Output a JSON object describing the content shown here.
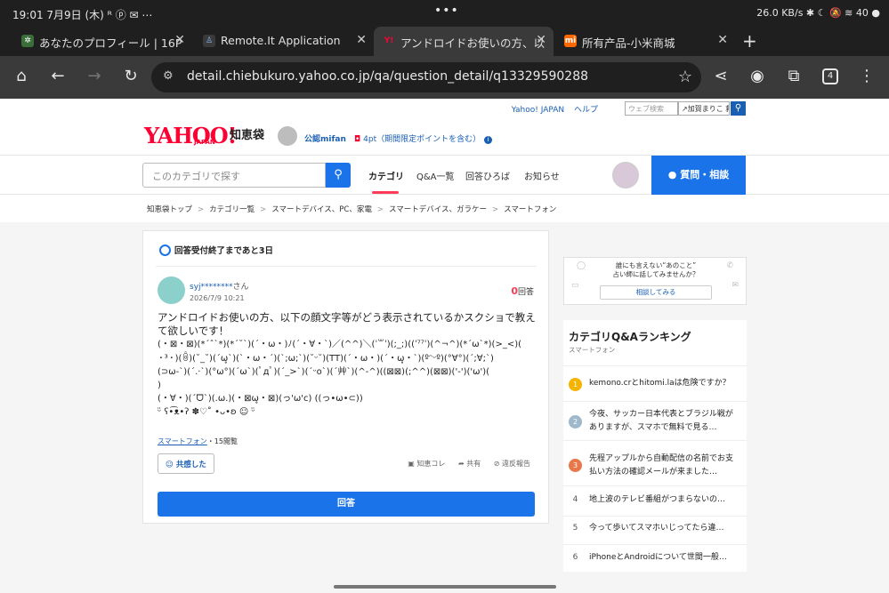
{
  "status_bar": {
    "time_date": "19:01  7月9日 (木)  ᴿ ⓟ ✉ ⋯",
    "center_dots": "•••",
    "right": "26.0 KB/s ✱ ☾ 🔕 ≋ 40 ●"
  },
  "tabs": [
    {
      "favicon": "✲",
      "favicon_color": "#3a6f3a",
      "label": "あなたのプロフィール | 16P",
      "close": "✕"
    },
    {
      "favicon": "♙",
      "favicon_color": "#3a3a3a",
      "label": "Remote.It Application",
      "close": "✕"
    },
    {
      "favicon": "Y!",
      "favicon_color": "#3a3a3a",
      "label": "アンドロイドお使いの方、以",
      "close": "✕"
    },
    {
      "favicon": "mi",
      "favicon_color": "#ff6700",
      "label": "所有产品-小米商城",
      "close": "✕"
    }
  ],
  "new_tab": "+",
  "toolbar": {
    "home": "⌂",
    "back": "←",
    "forward": "→",
    "reload": "↻",
    "url": "detail.chiebukuro.yahoo.co.jp/qa/question_detail/q13329590288",
    "tune": "⚙",
    "star": "☆",
    "share": "⋖",
    "account": "◉",
    "extensions": "⧉",
    "tab_count": "4",
    "menu": "⋮"
  },
  "yahoo_top": {
    "links": [
      "Yahoo! JAPAN",
      "ヘルプ"
    ],
    "web_search_placeholder": "ウェブ検索",
    "area": "↗加賀まりこ 救…",
    "search_btn": "🔍"
  },
  "header": {
    "logo": "YAHOO!",
    "logo_sub": "JAPAN",
    "logo_jp": "知恵袋",
    "user": "公認mifan",
    "points": "4pt（期間限定ポイントを含む）",
    "points_icon": "◘",
    "info_icon": "i"
  },
  "nav": {
    "search_placeholder": "このカテゴリで探す",
    "search_icon": "⚲",
    "items": [
      "カテゴリ",
      "Q&A一覧",
      "回答ひろば",
      "お知らせ"
    ],
    "ask_button": "● 質問・相談"
  },
  "breadcrumb": [
    "知恵袋トップ",
    "カテゴリ一覧",
    "スマートデバイス、PC、家電",
    "スマートデバイス、ガラケー",
    "スマートフォン"
  ],
  "question": {
    "deadline": "回答受付終了まであと3日",
    "user": "syj********",
    "honorific": "さん",
    "date": "2026/7/9 10:21",
    "answer_count": "0",
    "answer_label": "回答",
    "text": "アンドロイドお使いの方、以下の顔文字等がどう表示されているかスクショで教えて欲しいです！",
    "kaomoji": [
      "(・⊠・⊠)(*´ˆ`*)(*´˘`)(´・ω・)ﾉ(´・∀・`)／(^^)＼(ˈ꒳ˈ)(;_;)((ˈ⁷⁷ˈ)(^¬^)(*´ω`*)(>_<)(",
      "・³・)(ꉺ)(˘_˘)(´ω̥`)(`・ω・´)(`;ω;`)(˘ᵕ˘)(TT)(´・ω・)(´・ω̥・`)(ºᵔᵕº)(°∀°)(´;∀;`)",
      "(⊃ω-`)(´.·`)(°ω°)(´ω`)(ﾟдﾟ)(´_>`)(´ᵕo`)(´艸`)(^-^)((⊠⊠)(;^^)(⊠⊠)('-')('ω')(",
      ")",
      "(・∀・)(ˊᗜˋ)(.ω.)(・⊠ω̥・⊠)(っ'ω'c) ((っ•ω•⊂))",
      "ᵕ̈ ʕ•͡ᴥ•ʔ ✽♡˚ •ᴗ•ʚ ☺ ᵕ̈"
    ],
    "category": "スマートフォン",
    "views": "・15閲覧",
    "kyokan": "共感した",
    "actions": [
      "▣ 知恵コレ",
      "➦ 共有",
      "⊘ 違反報告"
    ],
    "answer_button": "回答"
  },
  "ad": {
    "line1": "誰にも言えない“あのこと”",
    "line2": "占い師に話してみませんか？",
    "button": "相談してみる"
  },
  "ranking": {
    "title": "カテゴリQ&Aランキング",
    "subtitle": "スマートフォン",
    "items": [
      {
        "n": "1",
        "color": "#f5b400",
        "text": "kemono.crとhitomi.laは危険ですか？"
      },
      {
        "n": "2",
        "color": "#9fb8cc",
        "text": "今夜、サッカー日本代表とブラジル戦がありますが、スマホで無料で見る…"
      },
      {
        "n": "3",
        "color": "#e8774a",
        "text": "先程アップルから自動配信の名前でお支払い方法の確認メールが来ました…"
      },
      {
        "n": "4",
        "color": "",
        "text": "地上波のテレビ番組がつまらないの…"
      },
      {
        "n": "5",
        "color": "",
        "text": "今って歩いてスマホいじってたら違…"
      },
      {
        "n": "6",
        "color": "",
        "text": "iPhoneとAndroidについて世間一般…"
      }
    ]
  }
}
